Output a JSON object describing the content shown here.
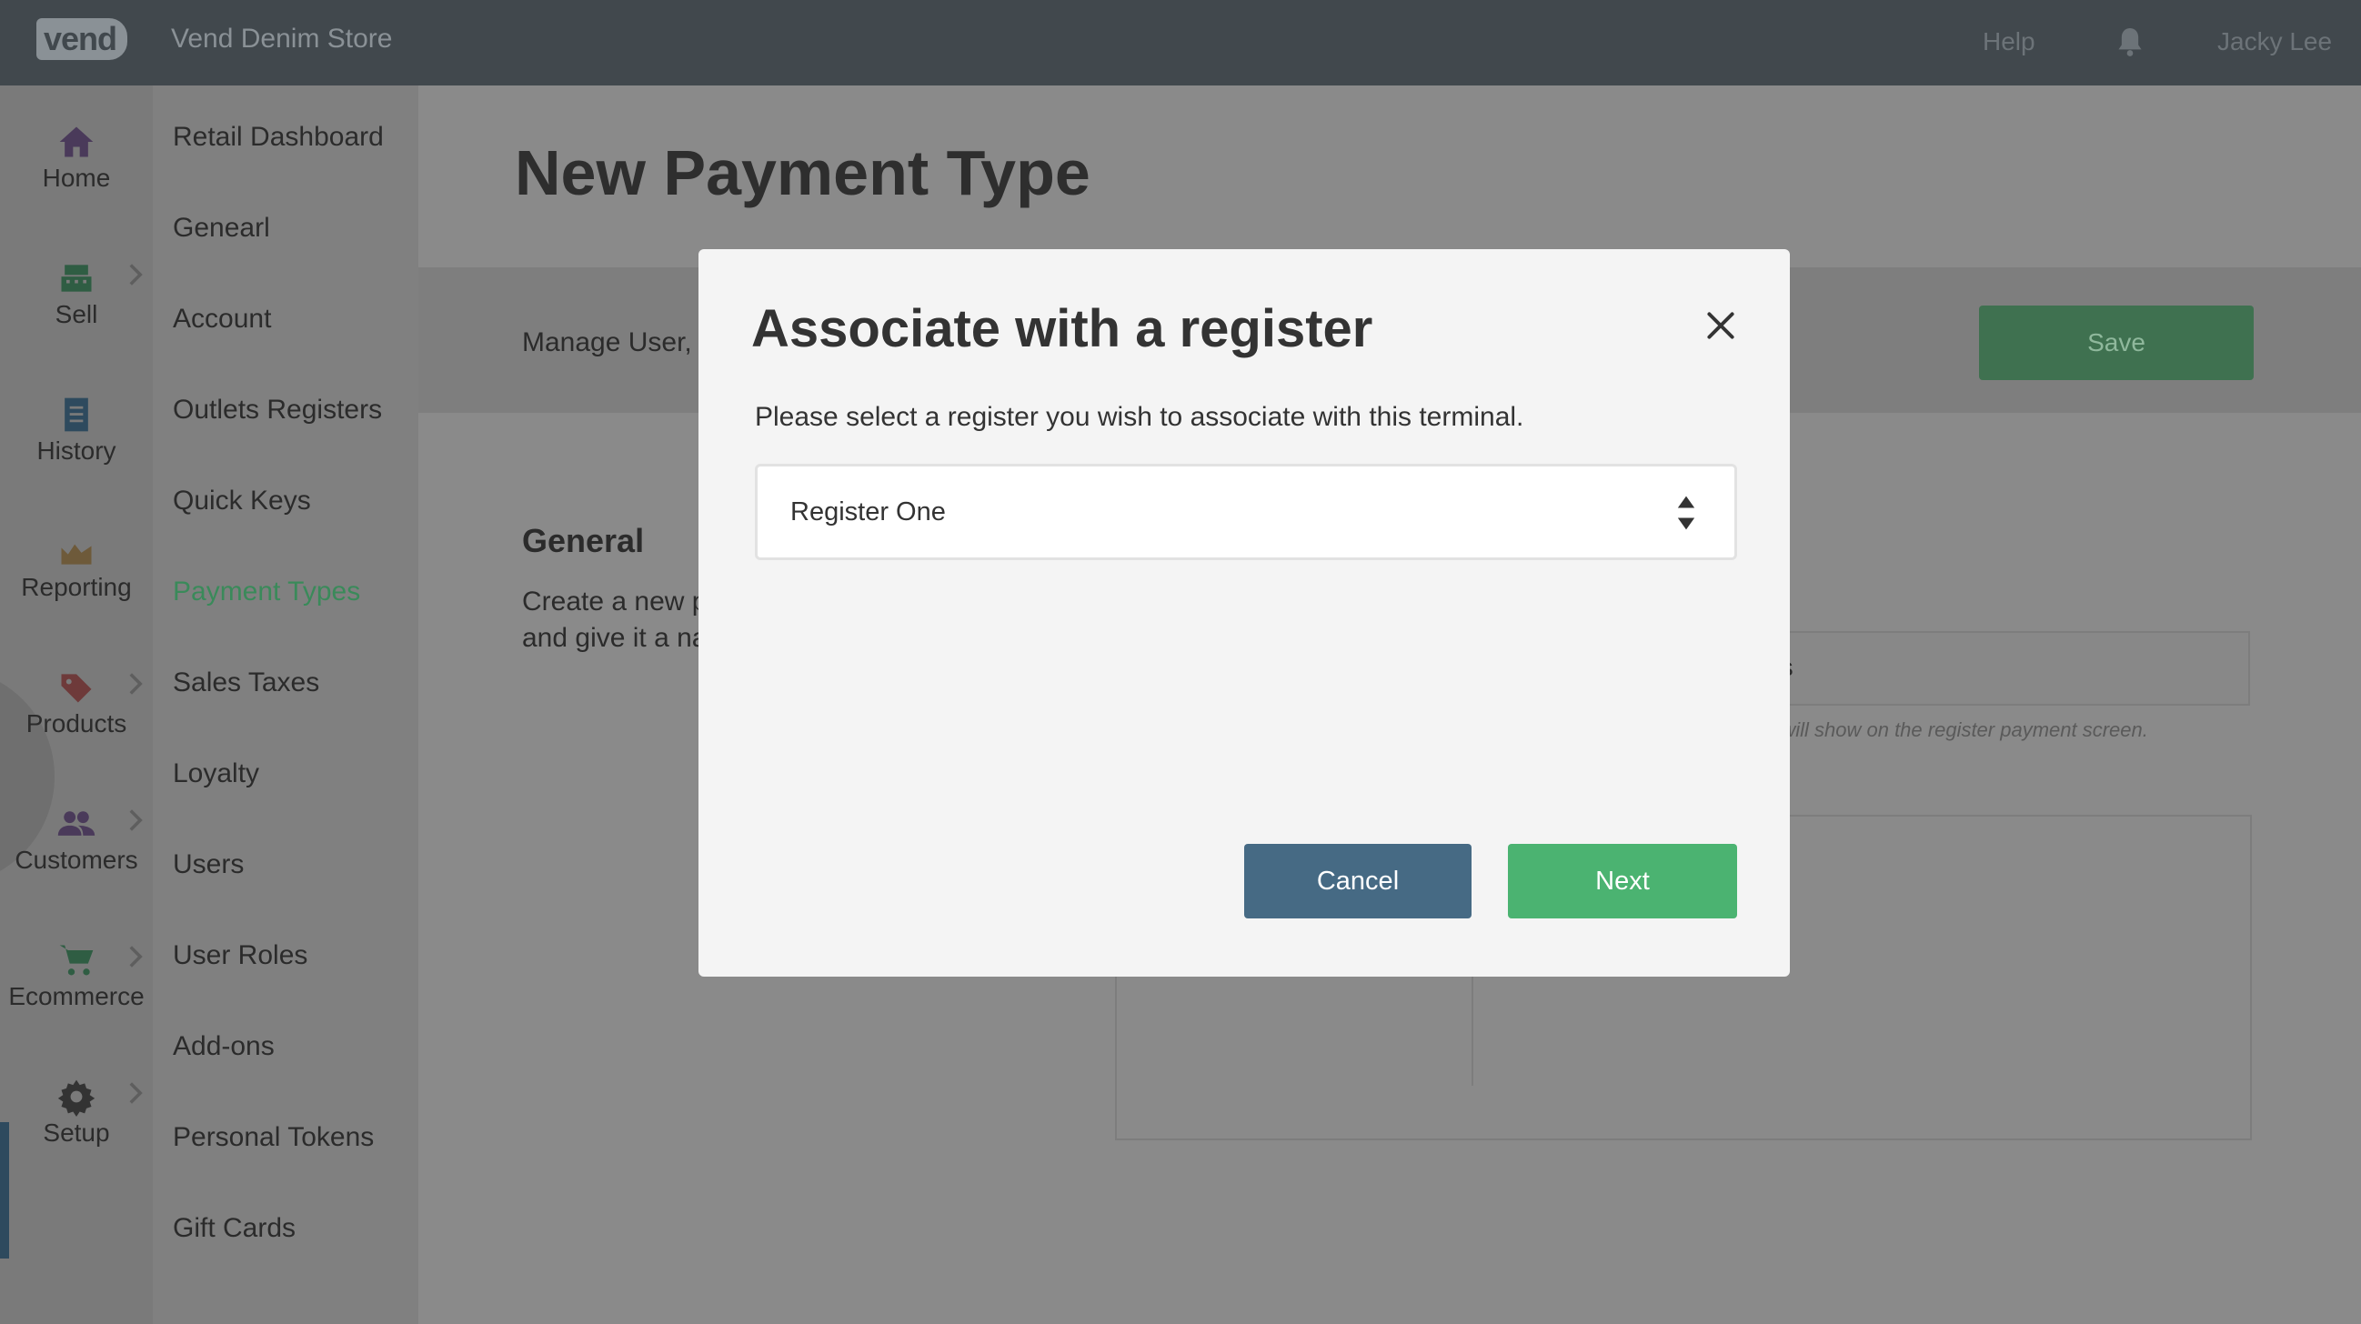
{
  "topbar": {
    "logo_text": "vend",
    "store_name": "Vend Denim Store",
    "help": "Help",
    "user": "Jacky Lee"
  },
  "rail": [
    {
      "label": "Home",
      "icon": "home-icon"
    },
    {
      "label": "Sell",
      "icon": "register-icon"
    },
    {
      "label": "History",
      "icon": "history-icon"
    },
    {
      "label": "Reporting",
      "icon": "chart-icon"
    },
    {
      "label": "Products",
      "icon": "tag-icon"
    },
    {
      "label": "Customers",
      "icon": "people-icon"
    },
    {
      "label": "Ecommerce",
      "icon": "cart-icon"
    },
    {
      "label": "Setup",
      "icon": "gear-icon"
    }
  ],
  "submenu": [
    "Retail Dashboard",
    "Genearl",
    "Account",
    "Outlets Registers",
    "Quick Keys",
    "Payment Types",
    "Sales Taxes",
    "Loyalty",
    "Users",
    "User Roles",
    "Add-ons",
    "Personal Tokens",
    "Gift Cards"
  ],
  "page": {
    "title": "New Payment Type",
    "toolbar_text": "Manage User, F",
    "save_label": "Save",
    "section_title": "General",
    "section_desc_1": "Create a new p",
    "section_desc_2": "and give it a na",
    "input_tail": "os",
    "hint_tail": "e will show on the register payment screen."
  },
  "modal": {
    "title": "Associate with a register",
    "description": "Please select a register you wish to associate with this terminal.",
    "select_value": "Register One",
    "cancel_label": "Cancel",
    "next_label": "Next"
  },
  "colors": {
    "topbar": "#41484d",
    "active_menu": "#3a8a5a",
    "cancel": "#466a84",
    "next": "#4bb371"
  }
}
